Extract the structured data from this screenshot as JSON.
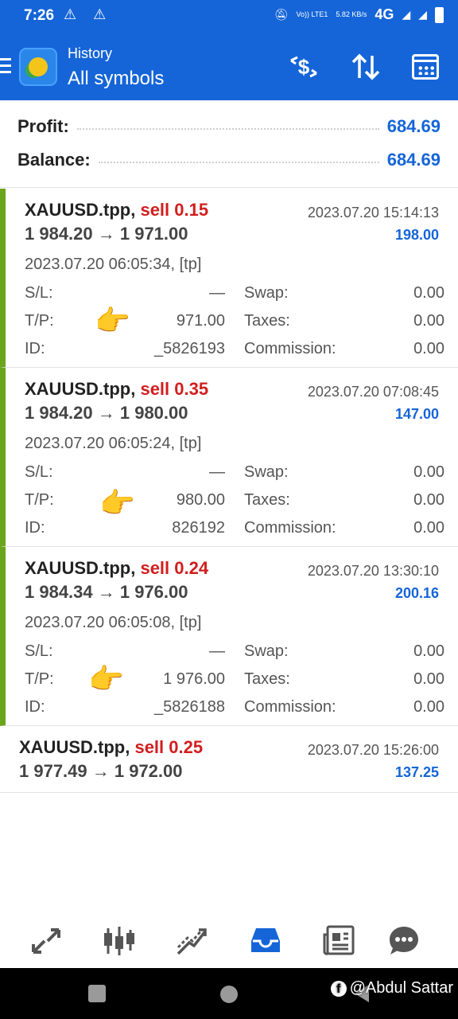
{
  "status": {
    "time": "7:26",
    "alerts": "⚠ ⚠",
    "volte": "Vo)) LTE1",
    "speed": "5.82 KB/s",
    "network": "4G"
  },
  "appbar": {
    "subtitle": "History",
    "title": "All symbols",
    "money_icon": "dollar-exchange-icon",
    "sort_icon": "sort-arrows-icon",
    "calendar_icon": "calendar-icon"
  },
  "summary": {
    "profit_label": "Profit:",
    "profit_value": "684.69",
    "balance_label": "Balance:",
    "balance_value": "684.69"
  },
  "trades": [
    {
      "symbol": "XAUUSD.tpp,",
      "side": "sell 0.15",
      "close_time": "2023.07.20 15:14:13",
      "prices": "1 984.20 → 1 971.00",
      "profit": "198.00",
      "open_time": "2023.07.20 06:05:34, [tp]",
      "sl_label": "S/L:",
      "sl": "—",
      "tp_label": "T/P:",
      "tp": "971.00",
      "id_label": "ID:",
      "id": "_5826193",
      "swap_label": "Swap:",
      "swap": "0.00",
      "taxes_label": "Taxes:",
      "taxes": "0.00",
      "commission_label": "Commission:",
      "commission": "0.00"
    },
    {
      "symbol": "XAUUSD.tpp,",
      "side": "sell 0.35",
      "close_time": "2023.07.20 07:08:45",
      "prices": "1 984.20 → 1 980.00",
      "profit": "147.00",
      "open_time": "2023.07.20 06:05:24, [tp]",
      "sl_label": "S/L:",
      "sl": "—",
      "tp_label": "T/P:",
      "tp": "980.00",
      "id_label": "ID:",
      "id": "826192",
      "swap_label": "Swap:",
      "swap": "0.00",
      "taxes_label": "Taxes:",
      "taxes": "0.00",
      "commission_label": "Commission:",
      "commission": "0.00"
    },
    {
      "symbol": "XAUUSD.tpp,",
      "side": "sell 0.24",
      "close_time": "2023.07.20 13:30:10",
      "prices": "1 984.34 → 1 976.00",
      "profit": "200.16",
      "open_time": "2023.07.20 06:05:08, [tp]",
      "sl_label": "S/L:",
      "sl": "—",
      "tp_label": "T/P:",
      "tp": "1 976.00",
      "id_label": "ID:",
      "id": "_5826188",
      "swap_label": "Swap:",
      "swap": "0.00",
      "taxes_label": "Taxes:",
      "taxes": "0.00",
      "commission_label": "Commission:",
      "commission": "0.00"
    },
    {
      "symbol": "XAUUSD.tpp,",
      "side": "sell 0.25",
      "close_time": "2023.07.20 15:26:00",
      "prices": "1 977.49 → 1 972.00",
      "profit": "137.25"
    }
  ],
  "pointer_emoji": "👉",
  "bottomnav": [
    "quotes-icon",
    "chart-candles-icon",
    "trade-icon",
    "history-icon",
    "news-icon",
    "chat-icon"
  ],
  "watermark": "@Abdul Sattar",
  "colors": {
    "brand": "#1565d8",
    "sell": "#d21e1e",
    "open_bar": "#6aa51c"
  }
}
